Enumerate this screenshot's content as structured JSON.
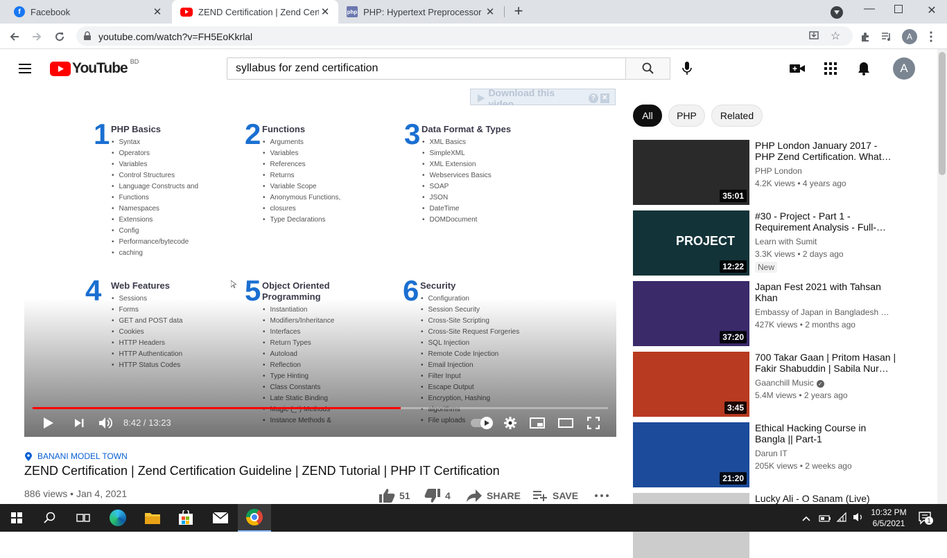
{
  "browser": {
    "tabs": [
      {
        "title": "Facebook",
        "favicon": "facebook-icon",
        "active": false
      },
      {
        "title": "ZEND Certification | Zend Certific",
        "favicon": "youtube-icon",
        "active": true
      },
      {
        "title": "PHP: Hypertext Preprocessor",
        "favicon": "php-icon",
        "active": false
      }
    ],
    "url": "youtube.com/watch?v=FH5EoKkrlal"
  },
  "header": {
    "logo_text": "YouTube",
    "region": "BD",
    "search_value": "syllabus for zend certification",
    "avatar_letter": "A"
  },
  "extension": {
    "download_label": "Download this video"
  },
  "player": {
    "progress": 0.64,
    "time": "8:42 / 13:23",
    "slide": {
      "columns": [
        {
          "num": "1",
          "title": "PHP Basics",
          "items": [
            "Syntax",
            "Operators",
            "Variables",
            "Control Structures",
            "Language Constructs and",
            "Functions",
            "Namespaces",
            "Extensions",
            "Config",
            "Performance/bytecode",
            "caching"
          ]
        },
        {
          "num": "2",
          "title": "Functions",
          "items": [
            "Arguments",
            "Variables",
            "References",
            "Returns",
            "Variable Scope",
            "Anonymous Functions,",
            "closures",
            "Type Declarations"
          ]
        },
        {
          "num": "3",
          "title": "Data Format & Types",
          "items": [
            "XML Basics",
            "SimpleXML",
            "XML Extension",
            "Webservices Basics",
            "SOAP",
            "JSON",
            "DateTime",
            "DOMDocument"
          ]
        },
        {
          "num": "4",
          "title": "Web Features",
          "items": [
            "Sessions",
            "Forms",
            "GET and POST data",
            "Cookies",
            "HTTP Headers",
            "HTTP Authentication",
            "HTTP Status Codes"
          ]
        },
        {
          "num": "5",
          "title": "Object Oriented Programming",
          "items": [
            "Instantiation",
            "Modifiers/Inheritance",
            "Interfaces",
            "Return Types",
            "Autoload",
            "Reflection",
            "Type Hinting",
            "Class Constants",
            "Late Static Binding",
            "Magic (_*) Methods",
            "Instance Methods &"
          ]
        },
        {
          "num": "6",
          "title": "Security",
          "items": [
            "Configuration",
            "Session Security",
            "Cross-Site Scripting",
            "Cross-Site Request Forgeries",
            "SQL Injection",
            "Remote Code Injection",
            "Email Injection",
            "Filter Input",
            "Escape Output",
            "Encryption, Hashing",
            "algorithms",
            "File uploads"
          ]
        }
      ]
    }
  },
  "video": {
    "location": "BANANI MODEL TOWN",
    "title": "ZEND Certification | Zend Certification Guideline | ZEND Tutorial | PHP IT Certification",
    "views": "886 views",
    "date": "Jan 4, 2021",
    "likes": "51",
    "dislikes": "4",
    "share_label": "SHARE",
    "save_label": "SAVE"
  },
  "sidebar": {
    "chips": [
      "All",
      "PHP",
      "Related"
    ],
    "videos": [
      {
        "title": "PHP London January 2017 - PHP Zend Certification. What…",
        "channel": "PHP London",
        "stats": "4.2K views • 4 years ago",
        "duration": "35:01",
        "badge": "",
        "thumb_color": "#2a2a2a"
      },
      {
        "title": "#30 - Project - Part 1 - Requirement Analysis - Full-…",
        "channel": "Learn with Sumit",
        "stats": "3.3K views • 2 days ago",
        "duration": "12:22",
        "badge": "New",
        "thumb_color": "#123338",
        "thumb_text": "PROJECT"
      },
      {
        "title": "Japan Fest 2021 with Tahsan Khan",
        "channel": "Embassy of Japan in Bangladesh …",
        "stats": "427K views • 2 months ago",
        "duration": "37:20",
        "badge": "",
        "thumb_color": "#3a2a6a"
      },
      {
        "title": "700 Takar Gaan | Pritom Hasan | Fakir Shabuddin | Sabila Nur…",
        "channel": "Gaanchill Music",
        "stats": "5.4M views • 2 years ago",
        "duration": "3:45",
        "badge": "",
        "thumb_color": "#b83a20"
      },
      {
        "title": "Ethical Hacking Course in Bangla || Part-1",
        "channel": "Darun IT",
        "stats": "205K views • 2 weeks ago",
        "duration": "21:20",
        "badge": "",
        "thumb_color": "#1b4b9a"
      },
      {
        "title": "Lucky Ali - O Sanam (Live)",
        "channel": "",
        "stats": "",
        "duration": "",
        "badge": "",
        "thumb_color": "#cccccc"
      }
    ]
  },
  "taskbar": {
    "time": "10:32 PM",
    "date": "6/5/2021",
    "notification_count": "1"
  }
}
